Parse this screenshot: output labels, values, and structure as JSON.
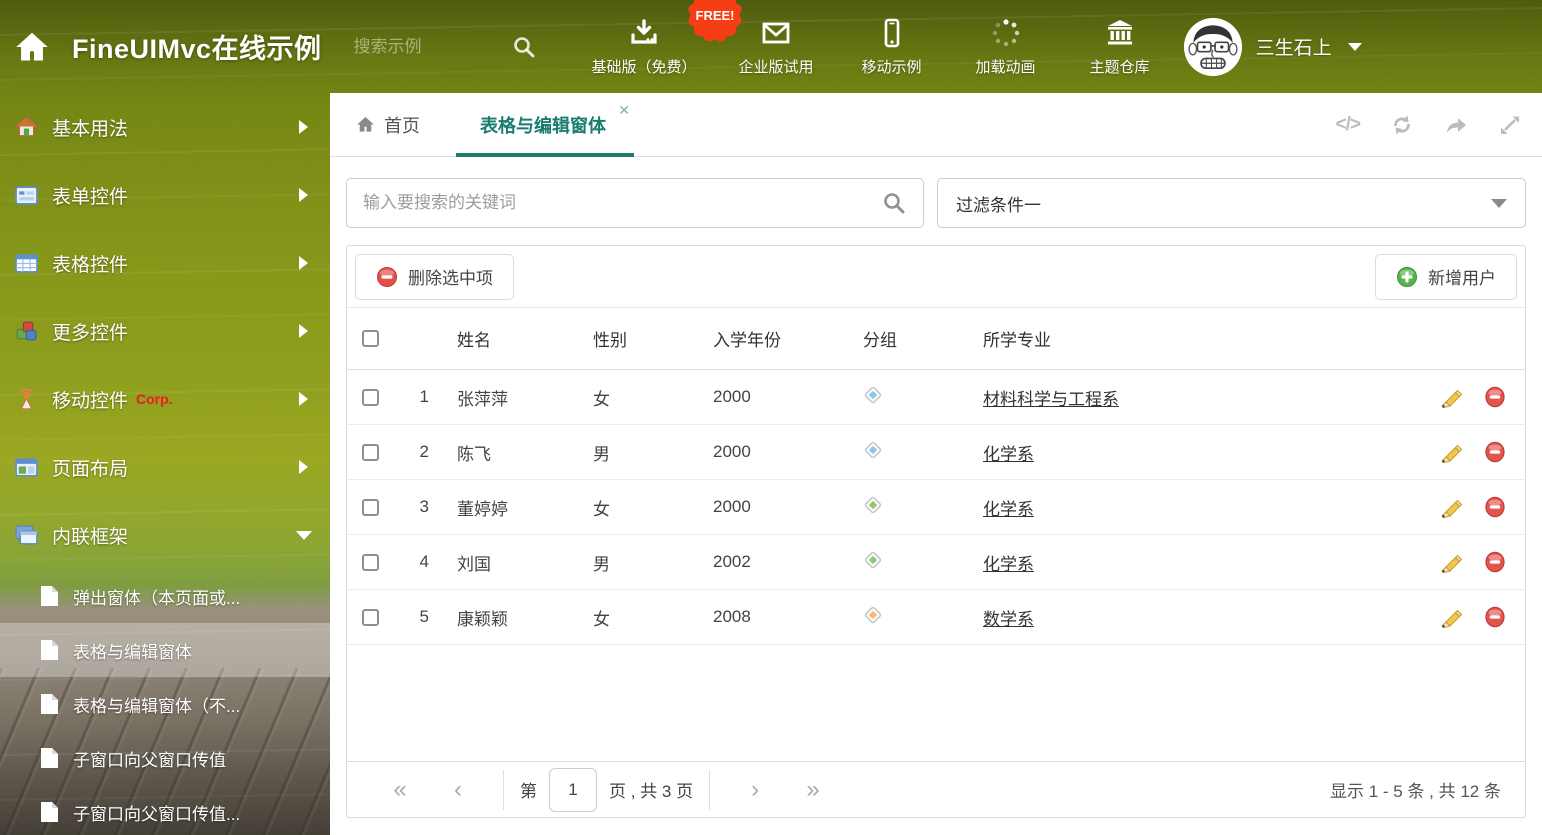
{
  "app": {
    "title": "FineUIMvc在线示例"
  },
  "header": {
    "search_placeholder": "搜索示例",
    "free_badge": "FREE!",
    "nav": [
      {
        "icon": "download-icon",
        "label": "基础版（免费）"
      },
      {
        "icon": "envelope-icon",
        "label": "企业版试用"
      },
      {
        "icon": "phone-icon",
        "label": "移动示例"
      },
      {
        "icon": "spinner-icon",
        "label": "加载动画"
      },
      {
        "icon": "bank-icon",
        "label": "主题仓库"
      }
    ],
    "user": {
      "name": "三生石上"
    }
  },
  "sidebar": {
    "items": [
      {
        "icon": "home-icon",
        "label": "基本用法"
      },
      {
        "icon": "form-icon",
        "label": "表单控件"
      },
      {
        "icon": "table-icon",
        "label": "表格控件"
      },
      {
        "icon": "cubes-icon",
        "label": "更多控件"
      },
      {
        "icon": "antenna-icon",
        "label": "移动控件",
        "badge": "Corp."
      },
      {
        "icon": "layout-icon",
        "label": "页面布局"
      },
      {
        "icon": "frames-icon",
        "label": "内联框架"
      }
    ],
    "subitems": [
      {
        "label": "弹出窗体（本页面或..."
      },
      {
        "label": "表格与编辑窗体",
        "active": true
      },
      {
        "label": "表格与编辑窗体（不..."
      },
      {
        "label": "子窗口向父窗口传值"
      },
      {
        "label": "子窗口向父窗口传值..."
      }
    ]
  },
  "tabs": {
    "home": "首页",
    "active": "表格与编辑窗体",
    "close_glyph": "✕"
  },
  "filterbar": {
    "search_placeholder": "输入要搜索的关键词",
    "filter_selected": "过滤条件一"
  },
  "grid": {
    "delete_button": "删除选中项",
    "add_button": "新增用户",
    "columns": {
      "name": "姓名",
      "gender": "性别",
      "year": "入学年份",
      "group": "分组",
      "major": "所学专业"
    },
    "rows": [
      {
        "index": "1",
        "name": "张萍萍",
        "gender": "女",
        "year": "2000",
        "tag_color": "#86c7f3",
        "major": "材料科学与工程系"
      },
      {
        "index": "2",
        "name": "陈飞",
        "gender": "男",
        "year": "2000",
        "tag_color": "#86c7f3",
        "major": "化学系"
      },
      {
        "index": "3",
        "name": "董婷婷",
        "gender": "女",
        "year": "2000",
        "tag_color": "#8fca6f",
        "major": "化学系"
      },
      {
        "index": "4",
        "name": "刘国",
        "gender": "男",
        "year": "2002",
        "tag_color": "#8fca6f",
        "major": "化学系"
      },
      {
        "index": "5",
        "name": "康颖颖",
        "gender": "女",
        "year": "2008",
        "tag_color": "#f8b878",
        "major": "数学系"
      }
    ]
  },
  "pagination": {
    "first_glyph": "«",
    "prev_glyph": "‹",
    "next_glyph": "›",
    "last_glyph": "»",
    "page_label_before": "第",
    "page_value": "1",
    "page_label_after": "页 , 共 3 页",
    "summary": "显示 1 - 5 条 , 共 12 条"
  },
  "colors": {
    "accent_teal": "#1a7c6f",
    "badge_orange": "#f63e14",
    "corp_red": "#ee1c1c"
  }
}
